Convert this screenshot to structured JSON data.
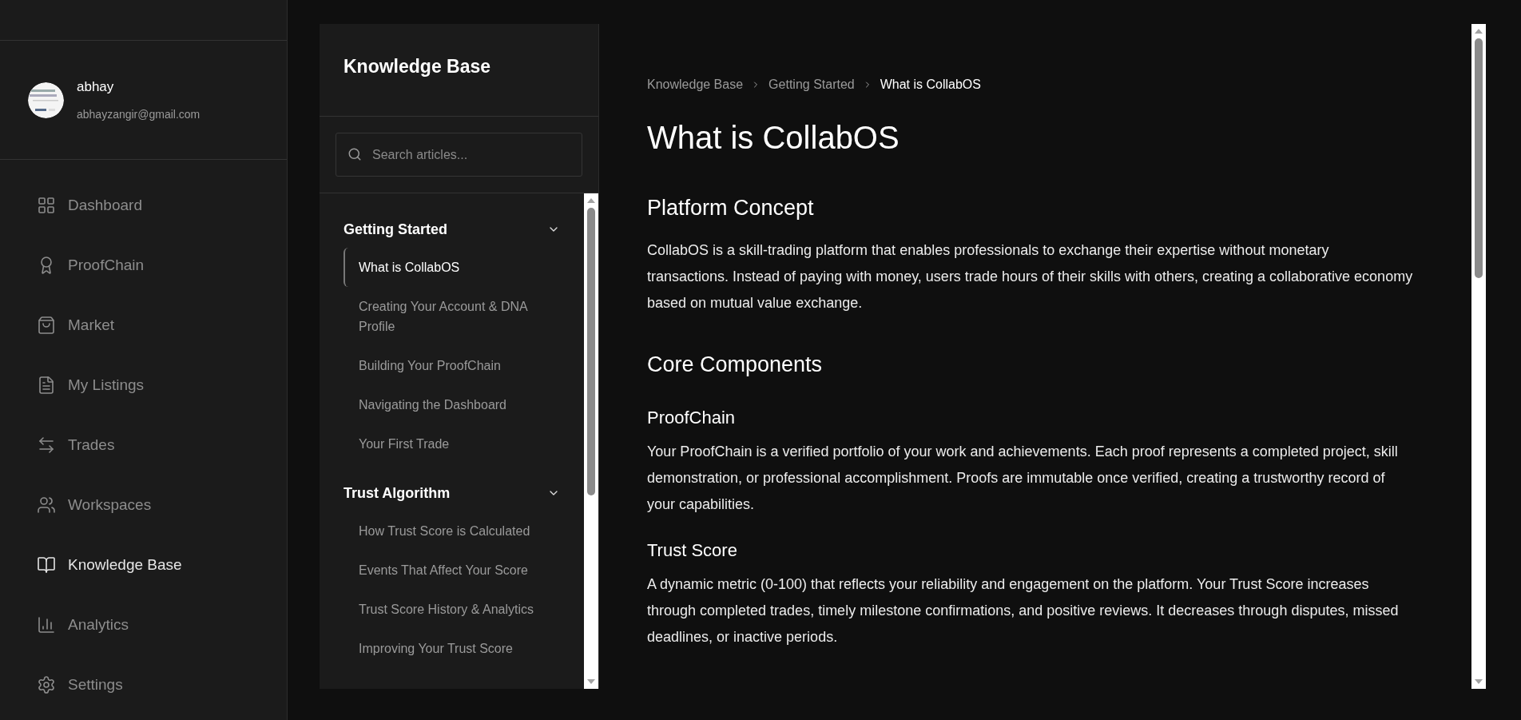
{
  "user": {
    "name": "abhay",
    "email": "abhayzangir@gmail.com"
  },
  "nav": [
    {
      "label": "Dashboard",
      "selected": false
    },
    {
      "label": "ProofChain",
      "selected": false
    },
    {
      "label": "Market",
      "selected": false
    },
    {
      "label": "My Listings",
      "selected": false
    },
    {
      "label": "Trades",
      "selected": false
    },
    {
      "label": "Workspaces",
      "selected": false
    },
    {
      "label": "Knowledge Base",
      "selected": true
    },
    {
      "label": "Analytics",
      "selected": false
    },
    {
      "label": "Settings",
      "selected": false
    }
  ],
  "kb_panel": {
    "title": "Knowledge Base",
    "search": {
      "placeholder": "Search articles..."
    },
    "sections": [
      {
        "title": "Getting Started",
        "expanded": true,
        "articles": [
          {
            "title": "What is CollabOS",
            "selected": true
          },
          {
            "title": "Creating Your Account & DNA Profile",
            "selected": false
          },
          {
            "title": "Building Your ProofChain",
            "selected": false
          },
          {
            "title": "Navigating the Dashboard",
            "selected": false
          },
          {
            "title": "Your First Trade",
            "selected": false
          }
        ]
      },
      {
        "title": "Trust Algorithm",
        "expanded": true,
        "articles": [
          {
            "title": "How Trust Score is Calculated",
            "selected": false
          },
          {
            "title": "Events That Affect Your Score",
            "selected": false
          },
          {
            "title": "Trust Score History & Analytics",
            "selected": false
          },
          {
            "title": "Improving Your Trust Score",
            "selected": false
          }
        ]
      }
    ]
  },
  "breadcrumbs": [
    {
      "label": "Knowledge Base",
      "selected": false
    },
    {
      "label": "Getting Started",
      "selected": false
    },
    {
      "label": "What is CollabOS",
      "selected": true
    }
  ],
  "article": {
    "title": "What is CollabOS",
    "blocks": [
      {
        "kind": "h2",
        "text": "Platform Concept"
      },
      {
        "kind": "p",
        "text": "CollabOS is a skill-trading platform that enables professionals to exchange their expertise without monetary transactions. Instead of paying with money, users trade hours of their skills with others, creating a collaborative economy based on mutual value exchange."
      },
      {
        "kind": "h2",
        "text": "Core Components"
      },
      {
        "kind": "h3",
        "text": "ProofChain"
      },
      {
        "kind": "p",
        "text": "Your ProofChain is a verified portfolio of your work and achievements. Each proof represents a completed project, skill demonstration, or professional accomplishment. Proofs are immutable once verified, creating a trustworthy record of your capabilities."
      },
      {
        "kind": "h3",
        "text": "Trust Score"
      },
      {
        "kind": "p",
        "text": "A dynamic metric (0-100) that reflects your reliability and engagement on the platform. Your Trust Score increases through completed trades, timely milestone confirmations, and positive reviews. It decreases through disputes, missed deadlines, or inactive periods."
      }
    ]
  }
}
